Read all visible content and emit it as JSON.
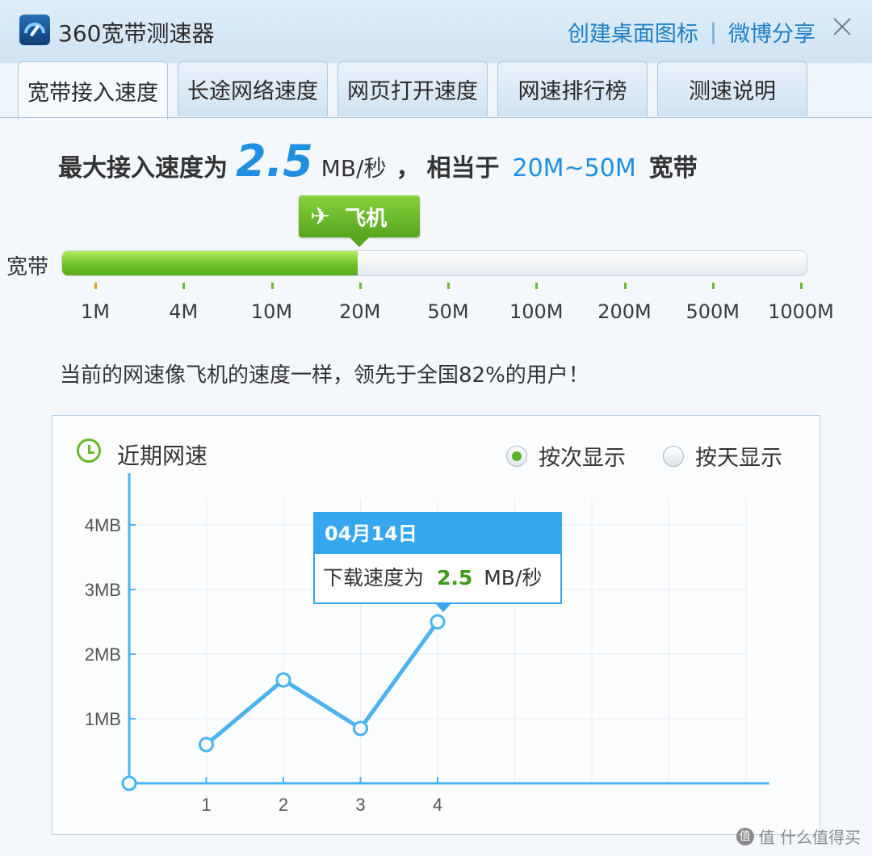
{
  "app": {
    "title": "360宽带测速器"
  },
  "top_links": {
    "create_shortcut": "创建桌面图标",
    "separator": "|",
    "weibo_share": "微博分享"
  },
  "tabs": [
    {
      "label": "宽带接入速度",
      "active": true
    },
    {
      "label": "长途网络速度",
      "active": false
    },
    {
      "label": "网页打开速度",
      "active": false
    },
    {
      "label": "网速排行榜",
      "active": false
    },
    {
      "label": "测速说明",
      "active": false
    }
  ],
  "headline": {
    "prefix": "最大接入速度为",
    "speed": "2.5",
    "unit": "MB/秒",
    "comma": "，",
    "equiv_prefix": "相当于",
    "range": "20M~50M",
    "suffix": "宽带"
  },
  "badge": {
    "label": "飞机",
    "icon": "plane-icon"
  },
  "bar": {
    "label": "宽带",
    "fill_fraction": 0.397
  },
  "scale": {
    "ticks": [
      "1M",
      "4M",
      "10M",
      "20M",
      "50M",
      "100M",
      "200M",
      "500M",
      "1000M"
    ]
  },
  "status_line": "当前的网速像飞机的速度一样，领先于全国82%的用户！",
  "panel": {
    "title": "近期网速",
    "radio_by_test": "按次显示",
    "radio_by_day": "按天显示",
    "selected": "按次显示"
  },
  "tooltip": {
    "date": "04月14日",
    "prefix": "下载速度为",
    "value": "2.5",
    "unit": "MB/秒"
  },
  "watermark": "值 什么值得买",
  "colors": {
    "accent": "#1f8fe0",
    "green": "#6bb72d",
    "line": "#4ab3f0"
  },
  "chart_data": {
    "type": "line",
    "title": "近期网速",
    "x": [
      1,
      2,
      3,
      4
    ],
    "series": [
      {
        "values": [
          0.6,
          1.6,
          0.85,
          2.5
        ]
      }
    ],
    "yticks": [
      "1MB",
      "2MB",
      "3MB",
      "4MB"
    ],
    "ylim": [
      0,
      4.4
    ],
    "xlim": [
      0,
      8.3
    ],
    "grid": true,
    "xlabel": "",
    "ylabel": ""
  }
}
